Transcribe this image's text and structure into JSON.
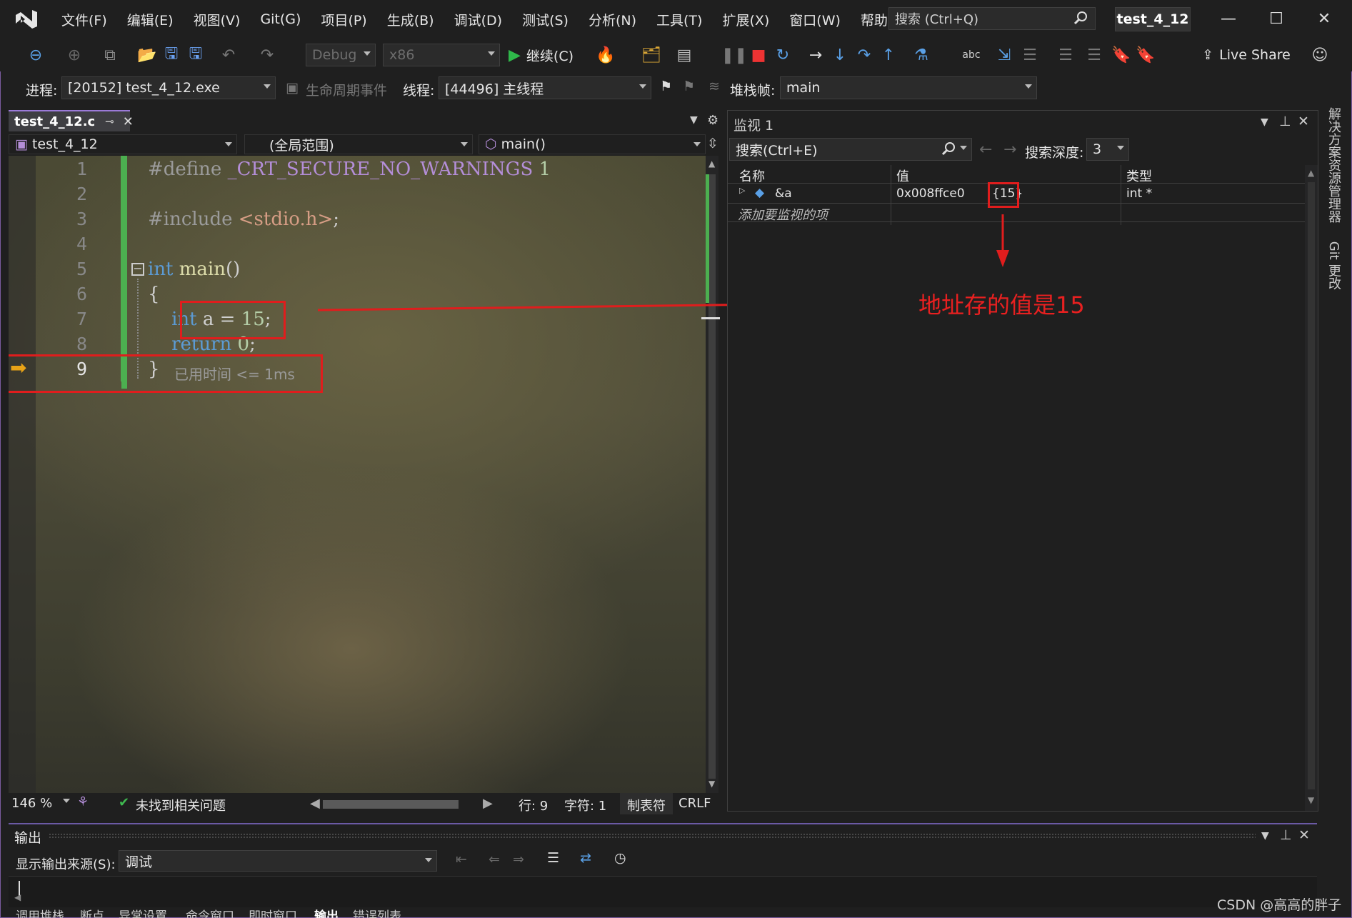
{
  "titlebar": {
    "menu": [
      "文件(F)",
      "编辑(E)",
      "视图(V)",
      "Git(G)",
      "项目(P)",
      "生成(B)",
      "调试(D)",
      "测试(S)",
      "分析(N)",
      "工具(T)",
      "扩展(X)",
      "窗口(W)",
      "帮助(H)"
    ],
    "search_placeholder": "搜索 (Ctrl+Q)",
    "project_name": "test_4_12"
  },
  "toolbar": {
    "config": "Debug",
    "platform": "x86",
    "continue_label": "继续(C)",
    "live_share": "Live Share"
  },
  "debugbar": {
    "process_label": "进程:",
    "process_value": "[20152] test_4_12.exe",
    "lifecycle_label": "生命周期事件",
    "thread_label": "线程:",
    "thread_value": "[44496] 主线程",
    "stack_label": "堆栈帧:",
    "stack_value": "main"
  },
  "editor": {
    "tab_name": "test_4_12.c",
    "nav_file": "test_4_12",
    "nav_scope": "(全局范围)",
    "nav_func": "main()",
    "lines": [
      {
        "n": "1",
        "text": "#define _CRT_SECURE_NO_WARNINGS 1"
      },
      {
        "n": "2",
        "text": ""
      },
      {
        "n": "3",
        "text": "#include <stdio.h>;"
      },
      {
        "n": "4",
        "text": ""
      },
      {
        "n": "5",
        "text": "int main()"
      },
      {
        "n": "6",
        "text": "{"
      },
      {
        "n": "7",
        "text": "    int a = 15;"
      },
      {
        "n": "8",
        "text": "    return 0;"
      },
      {
        "n": "9",
        "text": "}"
      }
    ],
    "elapsed": "已用时间 <= 1ms",
    "zoom": "146 %",
    "issues": "未找到相关问题",
    "row": "行: 9",
    "col": "字符: 1",
    "tabs_mode": "制表符",
    "eol": "CRLF"
  },
  "watch": {
    "title": "监视 1",
    "search_placeholder": "搜索(Ctrl+E)",
    "depth_label": "搜索深度:",
    "depth_value": "3",
    "columns": [
      "名称",
      "值",
      "类型"
    ],
    "rows": [
      {
        "name": "&a",
        "value_addr": "0x008ffce0",
        "value_deref": "{15}",
        "type": "int *"
      }
    ],
    "add_item": "添加要监视的项"
  },
  "annotation": "地址存的值是15",
  "side_tabs": [
    "解决方案资源管理器",
    "Git 更改"
  ],
  "output": {
    "title": "输出",
    "source_label": "显示输出来源(S):",
    "source_value": "调试"
  },
  "bottom_tabs": [
    "调用堆栈",
    "断点",
    "异常设置",
    "命令窗口",
    "即时窗口",
    "输出",
    "错误列表"
  ],
  "watermark": "CSDN @高高的胖子",
  "colors": {
    "accent": "#9b7ad8",
    "annotation_red": "#e01d1d",
    "green_bar": "#4caf50"
  }
}
